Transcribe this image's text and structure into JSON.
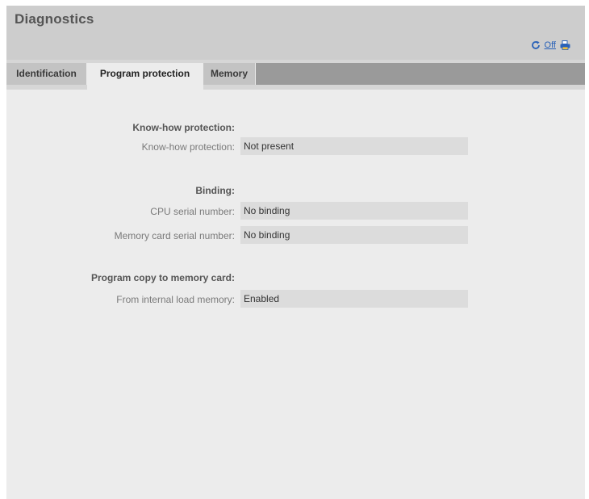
{
  "header": {
    "title": "Diagnostics",
    "refresh_icon": "refresh-icon",
    "off_label": "Off",
    "print_icon": "print-icon"
  },
  "tabs": [
    {
      "label": "Identification",
      "active": false
    },
    {
      "label": "Program protection",
      "active": true
    },
    {
      "label": "Memory",
      "active": false
    }
  ],
  "sections": {
    "know_how": {
      "title": "Know-how protection:",
      "fields": [
        {
          "label": "Know-how protection:",
          "value": "Not present"
        }
      ]
    },
    "binding": {
      "title": "Binding:",
      "fields": [
        {
          "label": "CPU serial number:",
          "value": "No binding"
        },
        {
          "label": "Memory card serial number:",
          "value": "No binding"
        }
      ]
    },
    "program_copy": {
      "title": "Program copy to memory card:",
      "fields": [
        {
          "label": "From internal load memory:",
          "value": "Enabled"
        }
      ]
    }
  },
  "colors": {
    "link": "#2a62b8",
    "header_bg": "#cdcdcd",
    "tab_strip": "#9a9a9a",
    "panel_bg": "#ececec"
  }
}
